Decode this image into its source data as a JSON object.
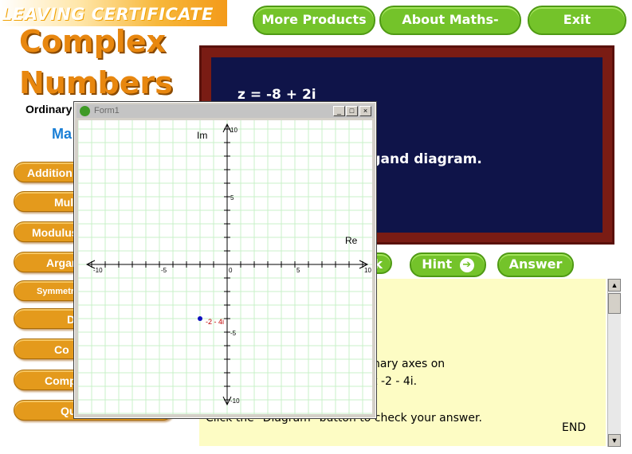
{
  "header": {
    "banner": "LEAVING CERTIFICATE",
    "title_line1": "Complex",
    "title_line2": "Numbers",
    "level": "Ordinary",
    "partial": "Ma"
  },
  "top_buttons": {
    "more_products": "More Products",
    "about": "About Maths-Master",
    "exit": "Exit"
  },
  "menu": [
    {
      "label": "Addition"
    },
    {
      "label": "Mul"
    },
    {
      "label": "Modulus"
    },
    {
      "label": "Argan"
    },
    {
      "label": "Symmetr"
    },
    {
      "label": "D"
    },
    {
      "label": "Co"
    },
    {
      "label": "Comp"
    },
    {
      "label": "Qu"
    }
  ],
  "board": {
    "equation": "z = -8 + 2i",
    "partial_line": "rgand diagram."
  },
  "mid_buttons": {
    "back_partial": "k",
    "hint": "Hint",
    "hint_arrow": "➔",
    "answer": "Answer"
  },
  "panel": {
    "line1": "nary axes on",
    "line2": "t -2 - 4i.",
    "line3": "Click the \"Diagram\" button to check your answer.",
    "end": "END",
    "scroll_up": "▲",
    "scroll_down": "▼"
  },
  "form": {
    "title": "Form1",
    "minimize": "_",
    "maximize": "□",
    "close": "×"
  },
  "chart_data": {
    "type": "scatter",
    "xlabel": "Re",
    "ylabel": "Im",
    "xlim": [
      -10,
      10
    ],
    "ylim": [
      -10,
      10
    ],
    "grid": true,
    "tick_labels_x": [
      "-10",
      "-5",
      "0",
      "5",
      "10"
    ],
    "tick_labels_y": [
      "10",
      "5",
      "-5",
      "-10"
    ],
    "points": [
      {
        "x": -2,
        "y": -4,
        "label": "-2 - 4i"
      }
    ],
    "colors": {
      "grid": "#c8f0c8",
      "axis": "#000000",
      "point": "#1010c0",
      "point_label": "#c00000"
    }
  }
}
